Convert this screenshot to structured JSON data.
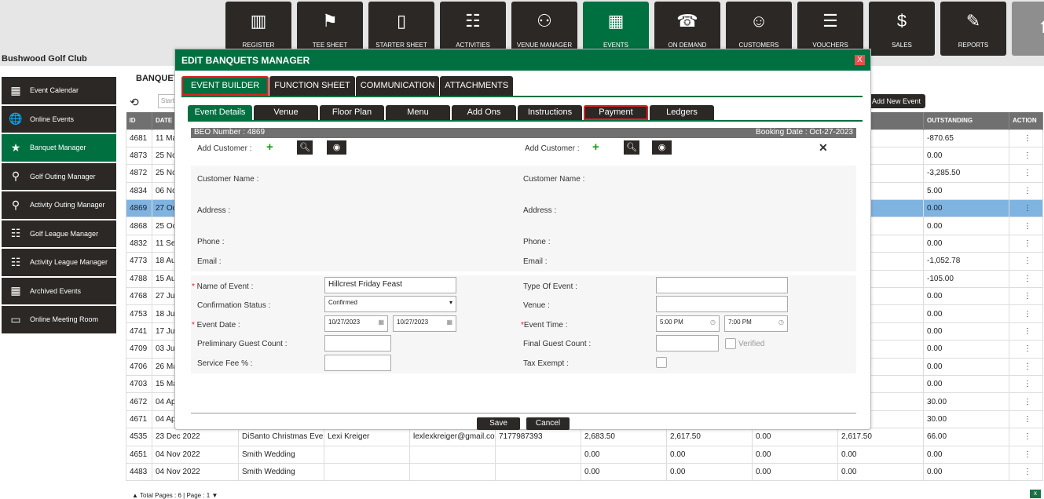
{
  "nav": [
    {
      "label": "REGISTER",
      "icon": "barcode-scanner-icon"
    },
    {
      "label": "TEE SHEET",
      "icon": "flag-sheet-icon"
    },
    {
      "label": "STARTER SHEET",
      "icon": "tablet-icon"
    },
    {
      "label": "ACTIVITIES",
      "icon": "calendar-list-icon"
    },
    {
      "label": "VENUE MANAGER",
      "icon": "people-icon"
    },
    {
      "label": "EVENTS",
      "icon": "calendar-edit-icon",
      "active": true
    },
    {
      "label": "ON DEMAND",
      "icon": "phone-icon"
    },
    {
      "label": "CUSTOMERS",
      "icon": "users-icon"
    },
    {
      "label": "VOUCHERS",
      "icon": "document-icon"
    },
    {
      "label": "SALES",
      "icon": "money-icon"
    },
    {
      "label": "REPORTS",
      "icon": "report-icon"
    }
  ],
  "club": "Bushwood Golf Club",
  "sidebar": [
    "Event Calendar",
    "Online Events",
    "Banquet Manager",
    "Golf Outing Manager",
    "Activity Outing Manager",
    "Golf League Manager",
    "Activity League Manager",
    "Archived Events",
    "Online Meeting Room"
  ],
  "panel": {
    "title": "BANQUET",
    "start_placeholder": "Start",
    "add_new": "Add New Event",
    "footer": "Total Pages : 6 | Page : 1"
  },
  "table": {
    "headers": [
      "ID",
      "DATE",
      "",
      "",
      "",
      "",
      "",
      "",
      "",
      "",
      "OUTSTANDING",
      "ACTION"
    ],
    "rows": [
      [
        "4681",
        "11 Ma",
        "",
        "",
        "",
        "",
        "",
        "",
        "",
        "",
        "-870.65"
      ],
      [
        "4873",
        "25 No",
        "",
        "",
        "",
        "",
        "",
        "",
        "",
        "",
        "0.00"
      ],
      [
        "4872",
        "25 No",
        "",
        "",
        "",
        "",
        "",
        "",
        "",
        "",
        "-3,285.50"
      ],
      [
        "4834",
        "06 No",
        "",
        "",
        "",
        "",
        "",
        "",
        "",
        "",
        "5.00"
      ],
      [
        "4869",
        "27 Oc",
        "",
        "",
        "",
        "",
        "",
        "",
        "",
        "",
        "0.00"
      ],
      [
        "4868",
        "25 Oc",
        "",
        "",
        "",
        "",
        "",
        "",
        "",
        "",
        "0.00"
      ],
      [
        "4832",
        "11 Se",
        "",
        "",
        "",
        "",
        "",
        "",
        "",
        "",
        "0.00"
      ],
      [
        "4773",
        "18 Au",
        "",
        "",
        "",
        "",
        "",
        "",
        "",
        "",
        "-1,052.78"
      ],
      [
        "4788",
        "15 Au",
        "",
        "",
        "",
        "",
        "",
        "",
        "",
        "",
        "-105.00"
      ],
      [
        "4768",
        "27 Jul",
        "",
        "",
        "",
        "",
        "",
        "",
        "",
        "",
        "0.00"
      ],
      [
        "4753",
        "18 Jul",
        "",
        "",
        "",
        "",
        "",
        "",
        "",
        "",
        "0.00"
      ],
      [
        "4741",
        "17 Jul",
        "",
        "",
        "",
        "",
        "",
        "",
        "",
        "",
        "0.00"
      ],
      [
        "4709",
        "03 Jun",
        "",
        "",
        "",
        "",
        "",
        "",
        "",
        "",
        "0.00"
      ],
      [
        "4706",
        "26 Ma",
        "",
        "",
        "",
        "",
        "",
        "",
        "",
        "",
        "0.00"
      ],
      [
        "4703",
        "15 Ma",
        "",
        "",
        "",
        "",
        "",
        "",
        "",
        "",
        "0.00"
      ],
      [
        "4672",
        "04 Ap",
        "",
        "",
        "",
        "",
        "",
        "",
        "",
        "",
        "30.00"
      ],
      [
        "4671",
        "04 Ap",
        "",
        "",
        "",
        "",
        "",
        "",
        "",
        "",
        "30.00"
      ],
      [
        "4535",
        "23 Dec 2022",
        "DiSanto Christmas Eve E",
        "Lexi Kreiger",
        "lexlexkreiger@gmail.con",
        "7177987393",
        "2,683.50",
        "2,617.50",
        "0.00",
        "2,617.50",
        "66.00"
      ],
      [
        "4651",
        "04 Nov 2022",
        "Smith Wedding",
        "",
        "",
        "",
        "0.00",
        "0.00",
        "0.00",
        "0.00",
        "0.00"
      ],
      [
        "4483",
        "04 Nov 2022",
        "Smith Wedding",
        "",
        "",
        "",
        "0.00",
        "0.00",
        "0.00",
        "0.00",
        "0.00"
      ]
    ],
    "selected_id": "4869"
  },
  "dialog": {
    "title": "EDIT BANQUETS MANAGER",
    "close": "X",
    "tabs": [
      "EVENT BUILDER",
      "FUNCTION SHEET",
      "COMMUNICATION",
      "ATTACHMENTS"
    ],
    "subtabs": [
      "Event Details",
      "Venue",
      "Floor Plan",
      "Menu",
      "Add Ons",
      "Instructions",
      "Payment",
      "Ledgers"
    ],
    "beo": "BEO Number : 4869",
    "booking": "Booking Date : Oct-27-2023",
    "add_customer": "Add Customer :",
    "customer_name": "Customer Name :",
    "customer_name2": "Customer Name  :",
    "address": "Address :",
    "address2": "Address  :",
    "phone": "Phone  :",
    "email": "Email :",
    "email2": "Email  :",
    "form": {
      "name_label": "Name of Event :",
      "name_value": "Hillcrest Friday Feast",
      "status_label": "Confirmation Status :",
      "status_value": "Confirmed",
      "date_label": "Event Date :",
      "date_from": "10/27/2023",
      "date_to": "10/27/2023",
      "prelim_label": "Preliminary Guest Count :",
      "fee_label": "Service Fee % :",
      "type_label": "Type Of Event :",
      "venue_label": "Venue :",
      "time_label": "Event Time :",
      "time_from": "5:00 PM",
      "time_to": "7:00 PM",
      "final_label": "Final Guest Count :",
      "verified": "Verified",
      "tax_label": "Tax Exempt :"
    },
    "save": "Save",
    "cancel": "Cancel"
  }
}
